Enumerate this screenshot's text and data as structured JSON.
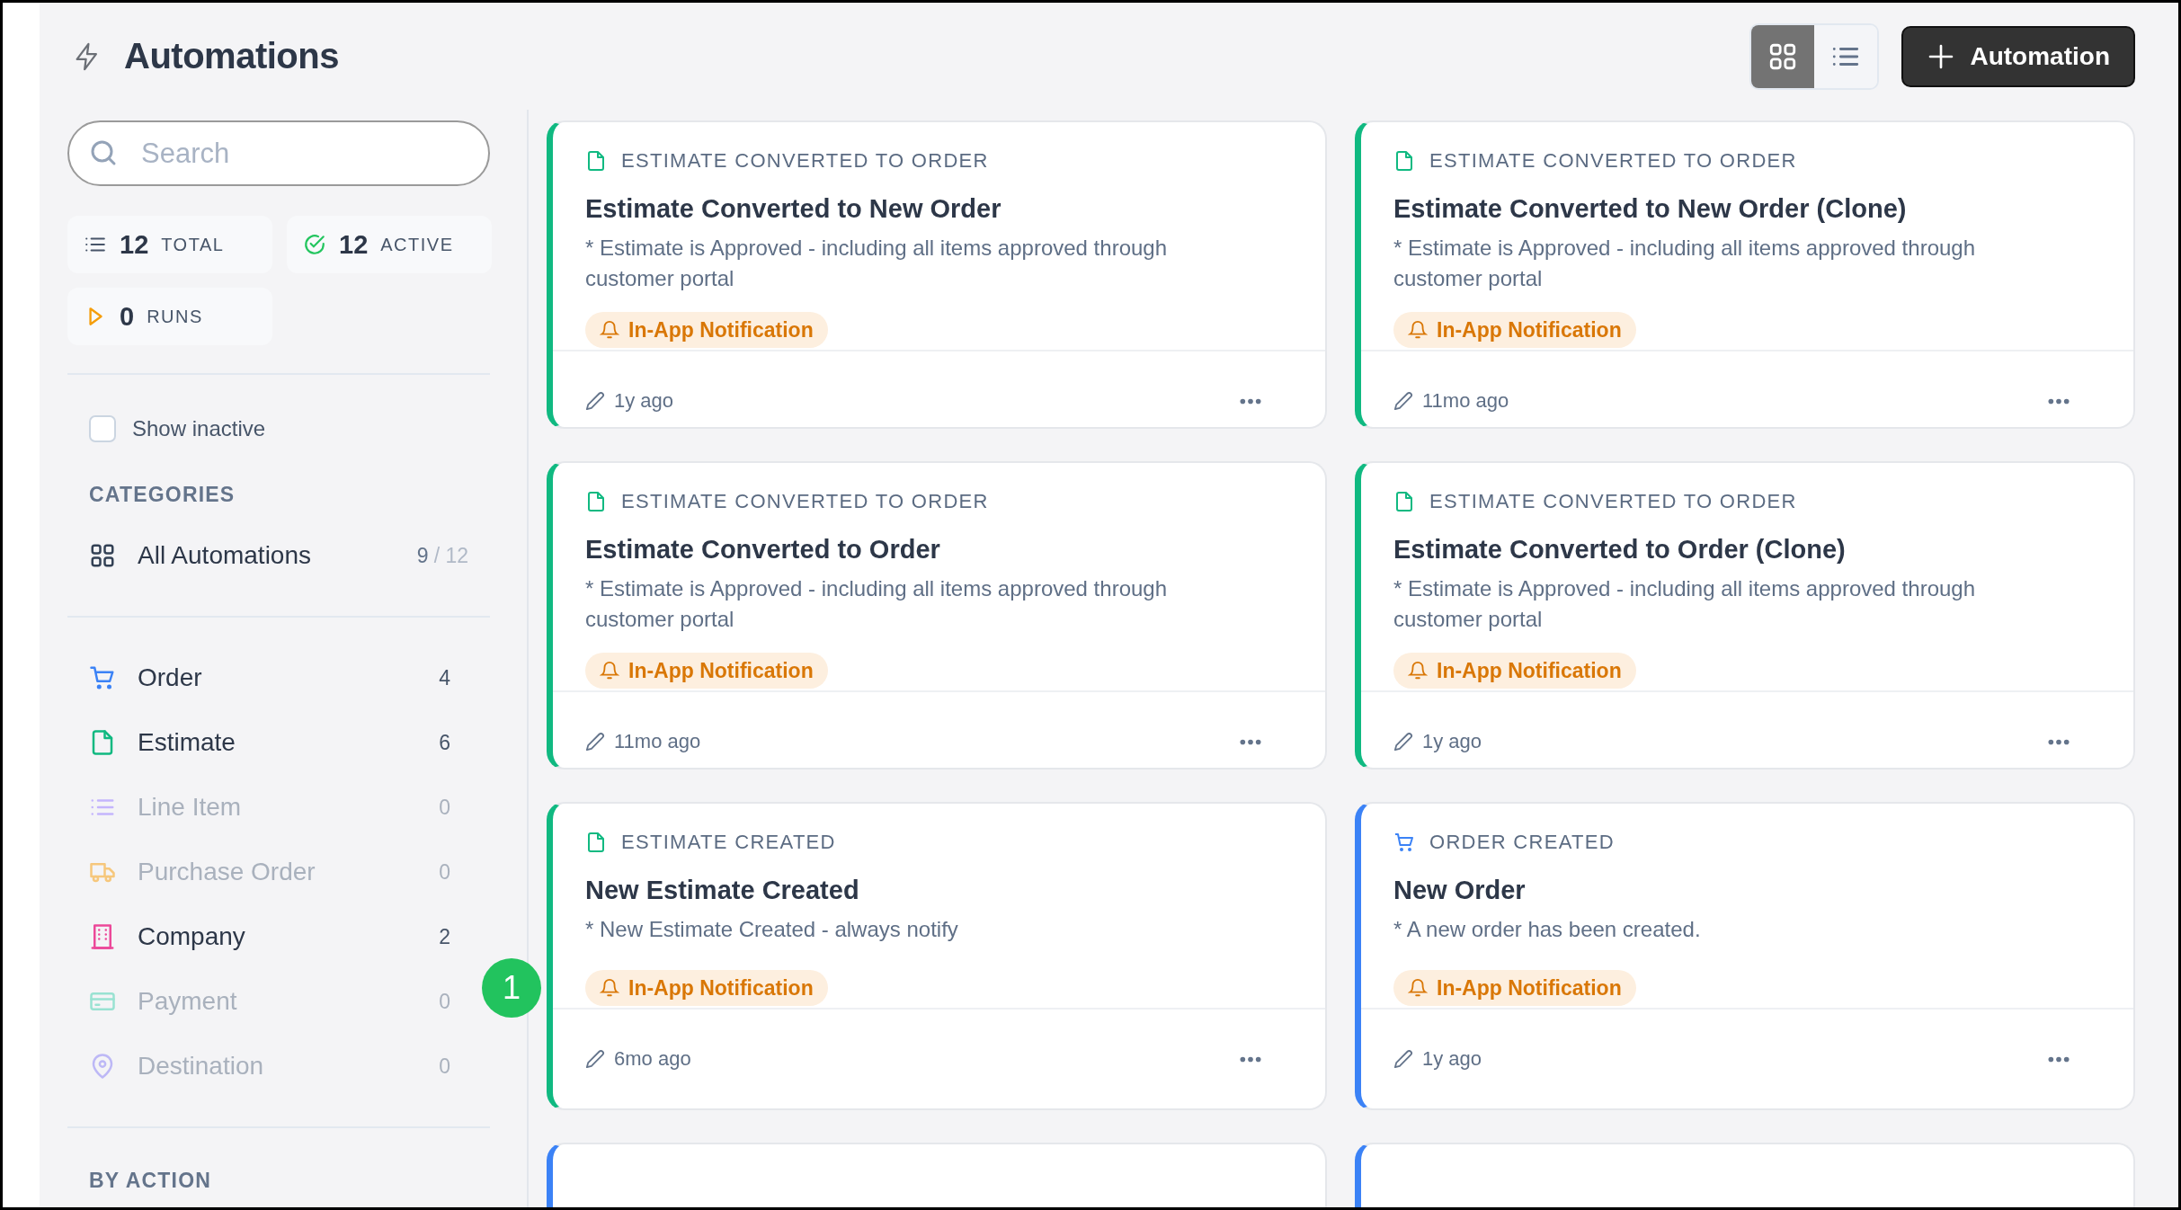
{
  "title": "Automations",
  "view_toggle": [
    {
      "kind": "grid",
      "selected": true
    },
    {
      "kind": "list",
      "selected": false
    }
  ],
  "new_button": "Automation",
  "search": {
    "placeholder": "Search"
  },
  "stats": [
    {
      "kind": "total",
      "value": "12",
      "label": "TOTAL"
    },
    {
      "kind": "active",
      "value": "12",
      "label": "ACTIVE"
    },
    {
      "kind": "runs",
      "value": "0",
      "label": "RUNS"
    }
  ],
  "show_inactive": {
    "label": "Show inactive",
    "checked": false
  },
  "categories_heading": "CATEGORIES",
  "all_item": {
    "label": "All Automations",
    "count": "9",
    "total": "/ 12"
  },
  "categories": [
    {
      "kind": "order",
      "label": "Order",
      "count": "4",
      "color": "#3b82f6",
      "disabled": false
    },
    {
      "kind": "estimate",
      "label": "Estimate",
      "count": "6",
      "color": "#10b981",
      "disabled": false
    },
    {
      "kind": "line_item",
      "label": "Line Item",
      "count": "0",
      "color": "#c4b5fd",
      "disabled": true
    },
    {
      "kind": "purchase_order",
      "label": "Purchase Order",
      "count": "0",
      "color": "#f6c77c",
      "disabled": true
    },
    {
      "kind": "company",
      "label": "Company",
      "count": "2",
      "color": "#ec4899",
      "disabled": false
    },
    {
      "kind": "payment",
      "label": "Payment",
      "count": "0",
      "color": "#99e2d2",
      "disabled": true
    },
    {
      "kind": "destination",
      "label": "Destination",
      "count": "0",
      "color": "#bdb8f6",
      "disabled": true
    }
  ],
  "by_action_heading": "BY ACTION",
  "step_badge": "1",
  "cards": [
    {
      "kind": "estimate",
      "category": "ESTIMATE CONVERTED TO ORDER",
      "title": "Estimate Converted to New Order",
      "description": "* Estimate is Approved - including all items approved through customer portal",
      "action": "In-App Notification",
      "edited": "1y ago"
    },
    {
      "kind": "estimate",
      "category": "ESTIMATE CONVERTED TO ORDER",
      "title": "Estimate Converted to New Order (Clone)",
      "description": "* Estimate is Approved - including all items approved through customer portal",
      "action": "In-App Notification",
      "edited": "11mo ago"
    },
    {
      "kind": "estimate",
      "category": "ESTIMATE CONVERTED TO ORDER",
      "title": "Estimate Converted to Order",
      "description": "* Estimate is Approved - including all items approved through customer portal",
      "action": "In-App Notification",
      "edited": "11mo ago"
    },
    {
      "kind": "estimate",
      "category": "ESTIMATE CONVERTED TO ORDER",
      "title": "Estimate Converted to Order (Clone)",
      "description": "* Estimate is Approved - including all items approved through customer portal",
      "action": "In-App Notification",
      "edited": "1y ago"
    },
    {
      "kind": "estimate",
      "category": "ESTIMATE CREATED",
      "title": "New Estimate Created",
      "description": "* New Estimate Created - always notify",
      "action": "In-App Notification",
      "edited": "6mo ago"
    },
    {
      "kind": "order",
      "category": "ORDER CREATED",
      "title": "New Order",
      "description": "* A new order has been created.",
      "action": "In-App Notification",
      "edited": "1y ago"
    },
    {
      "kind": "order"
    },
    {
      "kind": "order"
    }
  ]
}
